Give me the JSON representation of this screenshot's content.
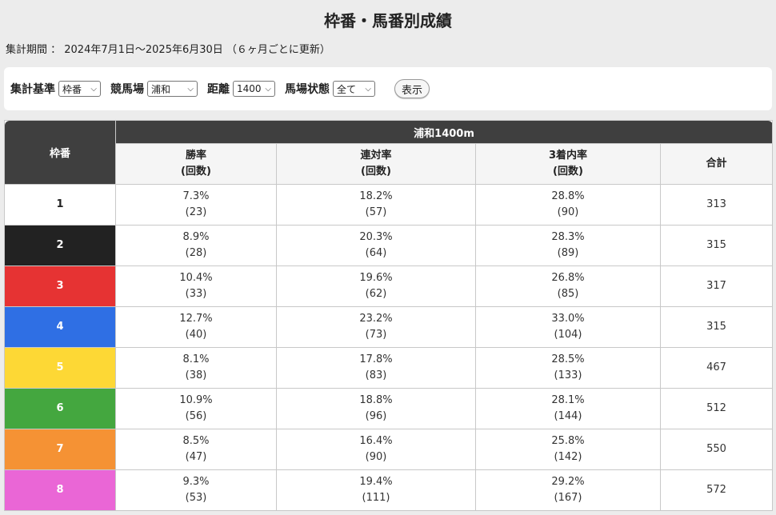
{
  "page": {
    "title": "枠番・馬番別成績",
    "period": "集計期間 ： 2024年7月1日～2025年6月30日 （６ヶ月ごとに更新）"
  },
  "filters": {
    "basis_label": "集計基準",
    "basis_value": "枠番",
    "course_label": "競馬場",
    "course_value": "浦和",
    "distance_label": "距離",
    "distance_value": "1400",
    "condition_label": "馬場状態",
    "condition_value": "全て",
    "show_button": "表示"
  },
  "table": {
    "waku_header": "枠番",
    "course_header": "浦和1400m",
    "columns": {
      "win": "勝率",
      "quinella": "連対率",
      "top3": "3着内率",
      "count_sub": "(回数)",
      "total": "合計"
    },
    "rows": [
      {
        "waku": "1",
        "bg": "#ffffff",
        "fg": "#222222",
        "win_rate": "7.3%",
        "win_n": "(23)",
        "q_rate": "18.2%",
        "q_n": "(57)",
        "t3_rate": "28.8%",
        "t3_n": "(90)",
        "total": "313"
      },
      {
        "waku": "2",
        "bg": "#222222",
        "fg": "#ffffff",
        "win_rate": "8.9%",
        "win_n": "(28)",
        "q_rate": "20.3%",
        "q_n": "(64)",
        "t3_rate": "28.3%",
        "t3_n": "(89)",
        "total": "315"
      },
      {
        "waku": "3",
        "bg": "#e63333",
        "fg": "#ffffff",
        "win_rate": "10.4%",
        "win_n": "(33)",
        "q_rate": "19.6%",
        "q_n": "(62)",
        "t3_rate": "26.8%",
        "t3_n": "(85)",
        "total": "317"
      },
      {
        "waku": "4",
        "bg": "#2f6fe4",
        "fg": "#ffffff",
        "win_rate": "12.7%",
        "win_n": "(40)",
        "q_rate": "23.2%",
        "q_n": "(73)",
        "t3_rate": "33.0%",
        "t3_n": "(104)",
        "total": "315"
      },
      {
        "waku": "5",
        "bg": "#fdd835",
        "fg": "#ffffff",
        "win_rate": "8.1%",
        "win_n": "(38)",
        "q_rate": "17.8%",
        "q_n": "(83)",
        "t3_rate": "28.5%",
        "t3_n": "(133)",
        "total": "467"
      },
      {
        "waku": "6",
        "bg": "#44a73f",
        "fg": "#ffffff",
        "win_rate": "10.9%",
        "win_n": "(56)",
        "q_rate": "18.8%",
        "q_n": "(96)",
        "t3_rate": "28.1%",
        "t3_n": "(144)",
        "total": "512"
      },
      {
        "waku": "7",
        "bg": "#f59234",
        "fg": "#ffffff",
        "win_rate": "8.5%",
        "win_n": "(47)",
        "q_rate": "16.4%",
        "q_n": "(90)",
        "t3_rate": "25.8%",
        "t3_n": "(142)",
        "total": "550"
      },
      {
        "waku": "8",
        "bg": "#ea66d6",
        "fg": "#ffffff",
        "win_rate": "9.3%",
        "win_n": "(53)",
        "q_rate": "19.4%",
        "q_n": "(111)",
        "t3_rate": "29.2%",
        "t3_n": "(167)",
        "total": "572"
      }
    ]
  }
}
